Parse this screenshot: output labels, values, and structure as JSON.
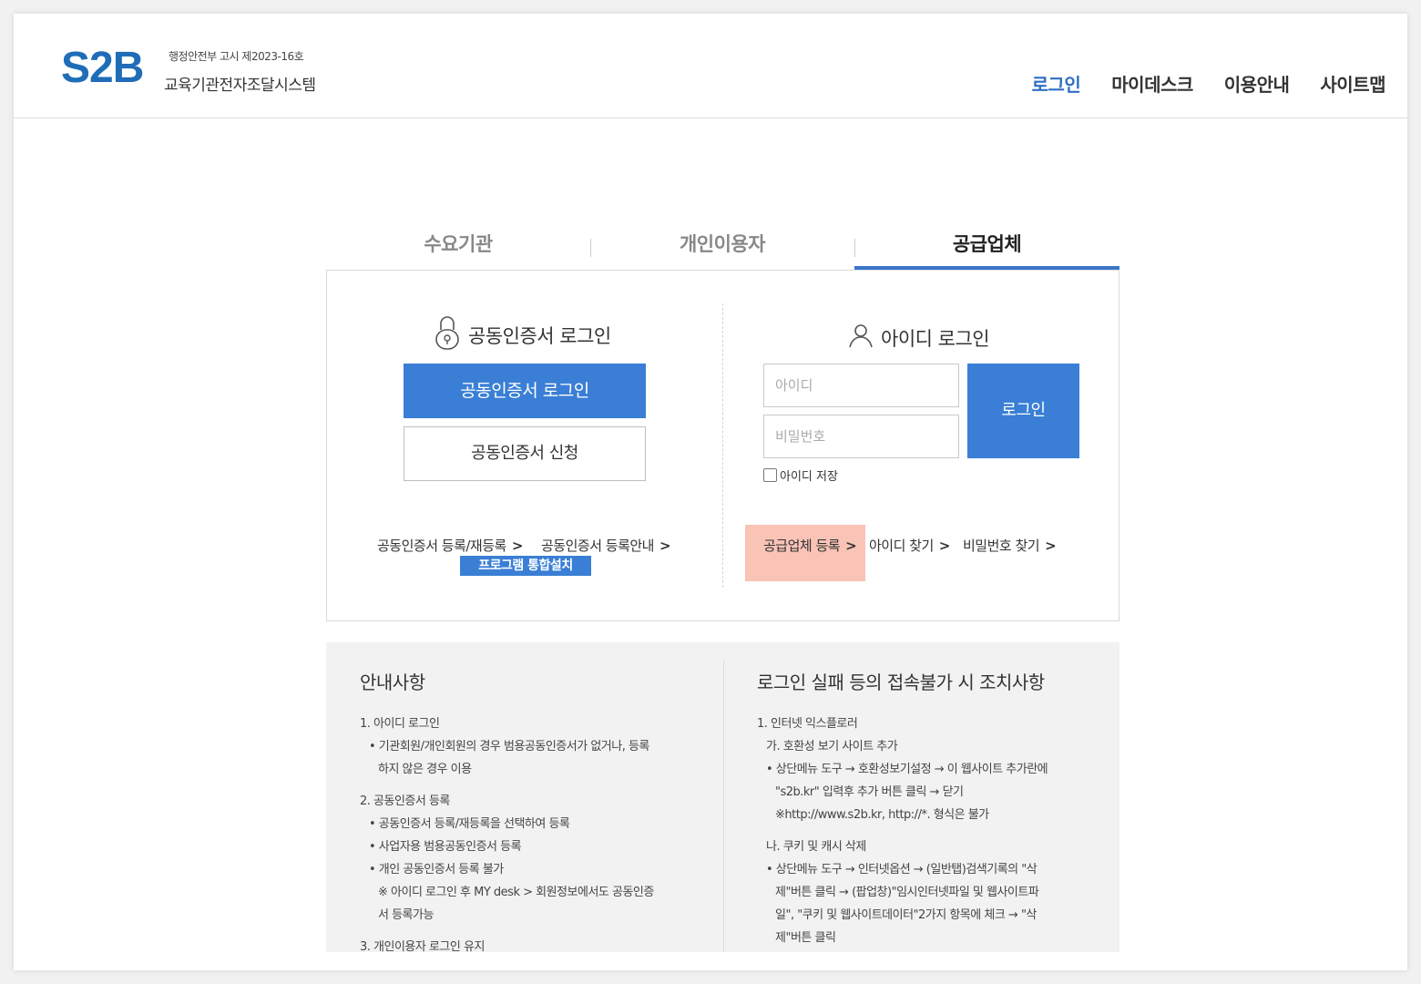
{
  "header": {
    "logo": "S2B",
    "notice": "행정안전부 고시 제2023-16호",
    "system_name": "교육기관전자조달시스템",
    "nav": [
      {
        "label": "로그인",
        "active": true
      },
      {
        "label": "마이데스크",
        "active": false
      },
      {
        "label": "이용안내",
        "active": false
      },
      {
        "label": "사이트맵",
        "active": false
      }
    ]
  },
  "tabs": [
    {
      "label": "수요기관",
      "active": false
    },
    {
      "label": "개인이용자",
      "active": false
    },
    {
      "label": "공급업체",
      "active": true
    }
  ],
  "cert_login": {
    "title": "공동인증서 로그인",
    "icon": "lock-icon",
    "login_button": "공동인증서 로그인",
    "apply_button": "공동인증서 신청",
    "links": [
      "공동인증서 등록/재등록",
      "공동인증서 등록안내"
    ],
    "install_button": "프로그램 통합설치"
  },
  "id_login": {
    "title": "아이디 로그인",
    "icon": "user-icon",
    "id_placeholder": "아이디",
    "pw_placeholder": "비밀번호",
    "login_button": "로그인",
    "save_id_label": "아이디 저장",
    "save_id_checked": false,
    "links": [
      "공급업체 등록",
      "아이디 찾기",
      "비밀번호 찾기"
    ],
    "highlight_color": "#f9c3b6"
  },
  "info": {
    "title": "안내사항",
    "lines": [
      "1. 아이디 로그인",
      "• 기관회원/개인회원의 경우 범용공동인증서가 없거나, 등록",
      "하지 않은 경우 이용",
      "2. 공동인증서 등록",
      "• 공동인증서 등록/재등록을 선택하여 등록",
      "• 사업자용 범용공동인증서 등록",
      "• 개인 공동인증서 등록 불가",
      "※ 아이디 로그인 후 MY desk > 회원정보에서도 공동인증",
      "서 등록가능",
      "3. 개인이용자 로그인 유지"
    ]
  },
  "trouble": {
    "title": "로그인 실패 등의 접속불가 시 조치사항",
    "lines": [
      "1. 인터넷 익스플로러",
      "가. 호환성 보기 사이트 추가",
      "• 상단메뉴 도구 → 호환성보기설정 → 이 웹사이트 추가란에",
      "\"s2b.kr\" 입력후 추가 버튼 클릭 → 닫기",
      "※http://www.s2b.kr, http://*. 형식은 불가",
      "나. 쿠키 및 캐시 삭제",
      "• 상단메뉴 도구 → 인터넷옵션 → (일반탭)검색기록의 \"삭",
      "제\"버튼 클릭 → (팝업창)\"임시인터넷파일 및 웹사이트파",
      "일\", \"쿠키 및 웹사이트데이터\"2가지 항목에 체크 → \"삭",
      "제\"버튼 클릭"
    ]
  },
  "colors": {
    "brand": "#1f6db8",
    "primary_button": "#3a7fd5",
    "active_tab_underline": "#3a75c9"
  }
}
